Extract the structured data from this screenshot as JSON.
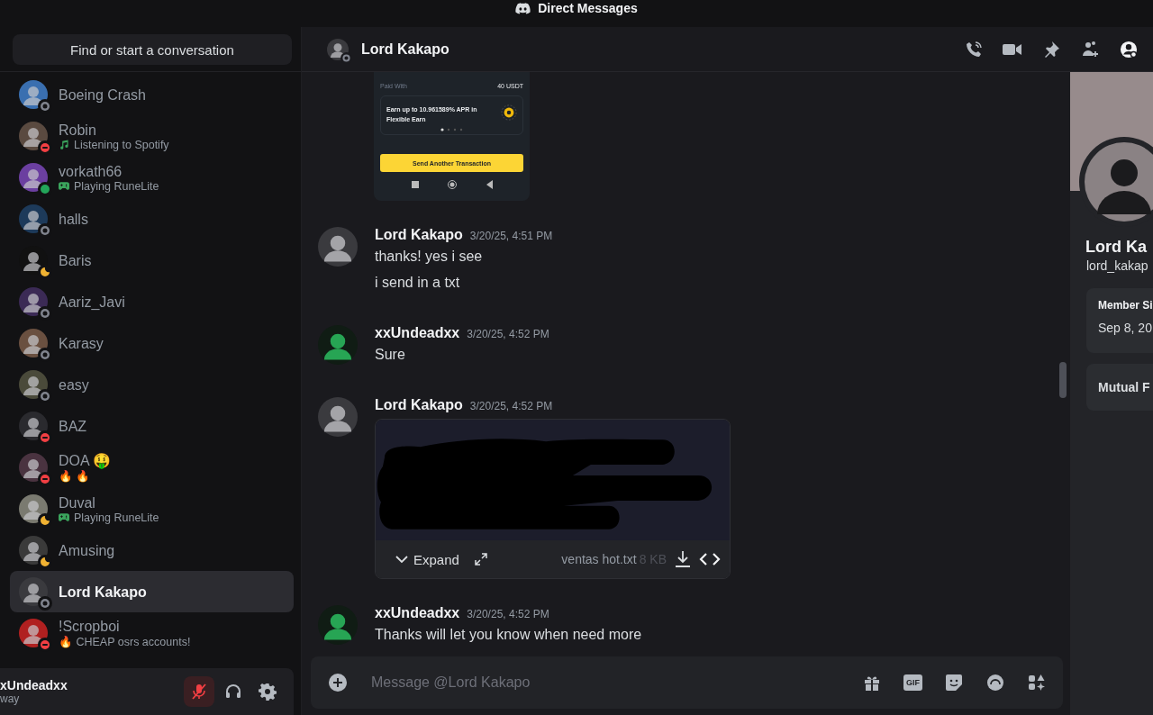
{
  "title_bar": {
    "title": "Direct Messages"
  },
  "sidebar": {
    "search": {
      "label": "Find or start a conversation"
    },
    "dms": [
      {
        "name": "Boeing Crash",
        "status": {
          "kind": "offline",
          "color": "#80848e"
        },
        "selected": false
      },
      {
        "name": "Robin",
        "status": {
          "kind": "dnd",
          "color": "#f23f43"
        },
        "selected": false,
        "activity": {
          "kind": "listening",
          "text": "Listening to Spotify"
        }
      },
      {
        "name": "vorkath66",
        "status": {
          "kind": "online",
          "color": "#23a55a"
        },
        "selected": false,
        "activity": {
          "kind": "game",
          "text": "Playing RuneLite"
        }
      },
      {
        "name": "halls",
        "status": {
          "kind": "offline",
          "color": "#80848e"
        },
        "selected": false
      },
      {
        "name": "Baris",
        "status": {
          "kind": "idle",
          "color": "#f0b232"
        },
        "selected": false
      },
      {
        "name": "Aariz_Javi",
        "status": {
          "kind": "offline",
          "color": "#80848e"
        },
        "selected": false
      },
      {
        "name": "Karasy",
        "status": {
          "kind": "offline",
          "color": "#80848e"
        },
        "selected": false
      },
      {
        "name": "easy",
        "status": {
          "kind": "offline",
          "color": "#80848e"
        },
        "selected": false
      },
      {
        "name": "BAZ",
        "status": {
          "kind": "dnd",
          "color": "#f23f43"
        },
        "selected": false
      },
      {
        "name": "DOA 🤑",
        "status": {
          "kind": "dnd",
          "color": "#f23f43"
        },
        "selected": false,
        "activity": {
          "kind": "custom",
          "text": "🔥 🔥"
        }
      },
      {
        "name": "Duval",
        "status": {
          "kind": "idle",
          "color": "#f0b232"
        },
        "selected": false,
        "activity": {
          "kind": "game",
          "text": "Playing RuneLite"
        }
      },
      {
        "name": "Amusing",
        "status": {
          "kind": "idle",
          "color": "#f0b232"
        },
        "selected": false
      },
      {
        "name": "Lord Kakapo",
        "status": {
          "kind": "offline",
          "color": "#80848e"
        },
        "selected": true
      },
      {
        "name": "!Scropboi",
        "status": {
          "kind": "dnd",
          "color": "#f23f43"
        },
        "selected": false,
        "activity": {
          "kind": "custom",
          "text": "🔥 CHEAP osrs accounts!"
        }
      }
    ],
    "user_panel": {
      "name": "xUndeadxx",
      "status": "way",
      "mic_muted": true
    }
  },
  "chat": {
    "header": {
      "name": "Lord Kakapo",
      "status": {
        "kind": "offline",
        "color": "#80848e"
      },
      "profile_open": true
    },
    "screenshot": {
      "rows": [
        {
          "label": "Paid With",
          "value": "40 USDT"
        }
      ],
      "promo": "Earn up to 10.961589% APR in Flexible Earn",
      "button": "Send Another Transaction"
    },
    "messages": [
      {
        "author": "Lord Kakapo",
        "own": false,
        "time": "3/20/25, 4:51 PM",
        "lines": [
          "thanks! yes i see",
          "i send in a txt"
        ]
      },
      {
        "author": "xxUndeadxx",
        "own": true,
        "time": "3/20/25, 4:52 PM",
        "lines": [
          "Sure"
        ]
      },
      {
        "author": "Lord Kakapo",
        "own": false,
        "time": "3/20/25, 4:52 PM",
        "attachment": {
          "expand": "Expand",
          "filename": "ventas hot.txt",
          "size": "8 KB"
        }
      },
      {
        "author": "xxUndeadxx",
        "own": true,
        "time": "3/20/25, 4:52 PM",
        "lines": [
          "Thanks will let you know when need more"
        ]
      }
    ],
    "composer": {
      "placeholder": "Message @Lord Kakapo",
      "gif_label": "GIF"
    }
  },
  "profile": {
    "display_name": "Lord Ka",
    "username": "lord_kakap",
    "member_label": "Member Si",
    "member_since": "Sep 8, 20",
    "mutual_label": "Mutual F"
  }
}
